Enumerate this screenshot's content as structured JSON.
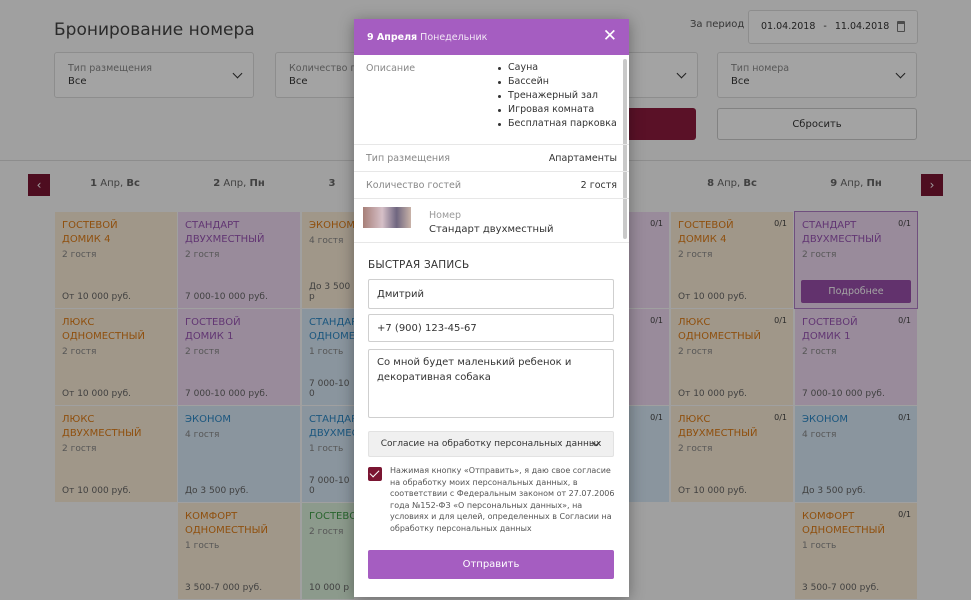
{
  "page": {
    "title": "Бронирование номера",
    "period_label": "За период",
    "period_from": "01.04.2018",
    "period_sep": "-",
    "period_to": "11.04.2018"
  },
  "filters": [
    {
      "label": "Тип размещения",
      "value": "Все"
    },
    {
      "label": "Количество го",
      "value": "Все"
    },
    {
      "label": "",
      "value": ""
    },
    {
      "label": "Тип номера",
      "value": "Все"
    }
  ],
  "buttons": {
    "reset": "Сбросить"
  },
  "days": [
    {
      "num": "1",
      "mon": "Апр,",
      "wd": "Вс"
    },
    {
      "num": "2",
      "mon": "Апр,",
      "wd": "Пн"
    },
    {
      "num": "3",
      "mon": "",
      "wd": ""
    },
    {
      "num": "8",
      "mon": "Апр,",
      "wd": "Вс"
    },
    {
      "num": "9",
      "mon": "Апр,",
      "wd": "Пн"
    }
  ],
  "grid": {
    "col1": [
      {
        "name": "Гостевой домик 4",
        "guests": "2 гостя",
        "price": "От 10 000 руб."
      },
      {
        "name": "Люкс одноместный",
        "guests": "2 гостя",
        "price": "От 10 000 руб."
      },
      {
        "name": "Люкс двухместный",
        "guests": "2 гостя",
        "price": "От 10 000 руб."
      }
    ],
    "col2": [
      {
        "name": "Стандарт двухместный",
        "guests": "2 гостя",
        "price": "7 000-10 000 руб."
      },
      {
        "name": "Гостевой домик 1",
        "guests": "2 гостя",
        "price": "7 000-10 000 руб."
      },
      {
        "name": "Эконом",
        "guests": "4 гостя",
        "price": "До 3 500 руб."
      },
      {
        "name": "Комфорт одноместный",
        "guests": "1 гость",
        "price": "3 500-7 000 руб."
      }
    ],
    "col3": [
      {
        "name": "Эконом",
        "guests": "4 гостя",
        "price": "До 3 500 р"
      },
      {
        "name": "Стандарт одноместный",
        "guests": "1 гость",
        "price": "7 000-10 0"
      },
      {
        "name": "Стандарт двухместный",
        "guests": "1 гость",
        "price": "7 000-10 0"
      },
      {
        "name": "Гостевой",
        "guests": "2 гостя",
        "price": "10 000 р"
      }
    ],
    "col4": [
      {
        "count": "0/1",
        "name": "Гостевой домик 4",
        "guests": "2 гостя",
        "price": "От 10 000 руб."
      },
      {
        "count": "0/1",
        "name": "Люкс одноместный",
        "guests": "2 гостя",
        "price": "От 10 000 руб."
      },
      {
        "count": "0/1",
        "name": "Люкс двухместный",
        "guests": "2 гостя",
        "price": "От 10 000 руб."
      }
    ],
    "col5": [
      {
        "count": "0/1",
        "name": "Стандарт двухместный",
        "guests": "2 гостя",
        "more": "Подробнее"
      },
      {
        "count": "0/1",
        "name": "Гостевой домик 1",
        "guests": "2 гостя",
        "price": "7 000-10 000 руб."
      },
      {
        "count": "0/1",
        "name": "Эконом",
        "guests": "4 гостя",
        "price": "До 3 500 руб."
      },
      {
        "count": "0/1",
        "name": "Комфорт одноместный",
        "guests": "1 гость",
        "price": "3 500-7 000 руб."
      }
    ],
    "stub": {
      "c1": "0/1",
      "c2": "0/1",
      "c3": "0/1"
    }
  },
  "modal": {
    "date": "9 Апреля",
    "weekday": "Понедельник",
    "close": "✕",
    "desc_label": "Описание",
    "amenities": [
      "Сауна",
      "Бассейн",
      "Тренажерный зал",
      "Игровая комната",
      "Бесплатная парковка"
    ],
    "placement_label": "Тип размещения",
    "placement_value": "Апартаменты",
    "guests_label": "Количество гостей",
    "guests_value": "2 гостя",
    "room_label": "Номер",
    "room_value": "Стандарт двухместный",
    "quick_title": "БЫСТРАЯ ЗАПИСЬ",
    "name_value": "Дмитрий",
    "phone_value": "+7 (900) 123-45-67",
    "comment_value": "Со мной будет маленький ребенок и декоративная собака",
    "consent_select": "Согласие на обработку персональных данных",
    "legal_text": "Нажимая кнопку «Отправить», я даю свое согласие на обработку моих персональных данных, в соответствии с Федеральным законом от 27.07.2006 года №152-ФЗ «О персональных данных», на условиях и для целей, определенных в Согласии на обработку персональных данных",
    "submit": "Отправить"
  }
}
